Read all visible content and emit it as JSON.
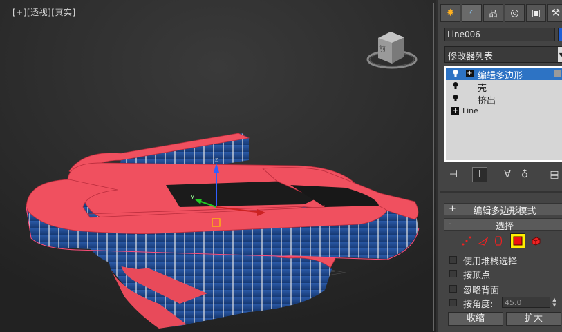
{
  "viewport": {
    "label": "[+][透视][真实]",
    "viewcube_face": "前"
  },
  "panel": {
    "tabs": [
      "create-icon",
      "modify-icon",
      "hierarchy-icon",
      "motion-icon",
      "display-icon",
      "utilities-icon"
    ],
    "object_name": "Line006",
    "object_color": "#1f5fd6",
    "modifier_list": "修改器列表",
    "stack": [
      {
        "label": "编辑多边形",
        "selected": true
      },
      {
        "label": "壳",
        "selected": false
      },
      {
        "label": "挤出",
        "selected": false
      },
      {
        "label": "Line",
        "selected": false
      }
    ],
    "rollouts": {
      "edit_poly_mode": {
        "sign": "+",
        "title": "编辑多边形模式"
      },
      "selection": {
        "sign": "-",
        "title": "选择"
      }
    },
    "options": {
      "use_stack": "使用堆栈选择",
      "by_vertex": "按顶点",
      "ignore_backface": "忽略背面",
      "by_angle": "按角度:",
      "angle_value": "45.0"
    },
    "buttons": {
      "shrink": "收缩",
      "grow": "扩大"
    }
  }
}
